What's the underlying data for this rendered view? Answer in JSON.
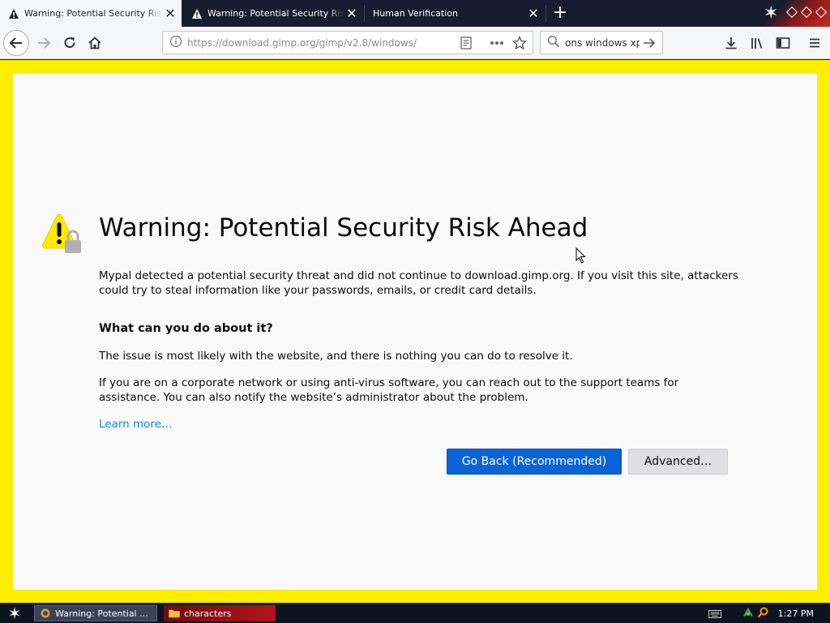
{
  "tabs": [
    {
      "title": "Warning: Potential Security Risk Ahead",
      "active": true,
      "icon": "warning-icon"
    },
    {
      "title": "Warning: Potential Security Risk Ahead",
      "active": false,
      "icon": "warning-icon"
    },
    {
      "title": "Human Verification",
      "active": false,
      "icon": ""
    }
  ],
  "navbar": {
    "url": "https://download.gimp.org/gimp/v2.8/windows/",
    "search_value": "ons windows xp"
  },
  "page": {
    "title": "Warning: Potential Security Risk Ahead",
    "intro": "Mypal detected a potential security threat and did not continue to download.gimp.org. If you visit this site, attackers could try to steal information like your passwords, emails, or credit card details.",
    "subheading": "What can you do about it?",
    "para1": "The issue is most likely with the website, and there is nothing you can do to resolve it.",
    "para2": "If you are on a corporate network or using anti-virus software, you can reach out to the support teams for assistance. You can also notify the website’s administrator about the problem.",
    "learn_more": "Learn more…",
    "go_back_label": "Go Back (Recommended)",
    "advanced_label": "Advanced…"
  },
  "taskbar": {
    "tasks": [
      {
        "label": "Warning: Potential ...",
        "icon": "firefox-icon"
      },
      {
        "label": "characters",
        "icon": "folder-icon"
      }
    ],
    "clock": "1:27 PM"
  },
  "colors": {
    "frame_yellow": "#ffee00",
    "primary_button": "#0a64d8",
    "link": "#0a8dd9",
    "warning_yellow": "#ffe900"
  }
}
